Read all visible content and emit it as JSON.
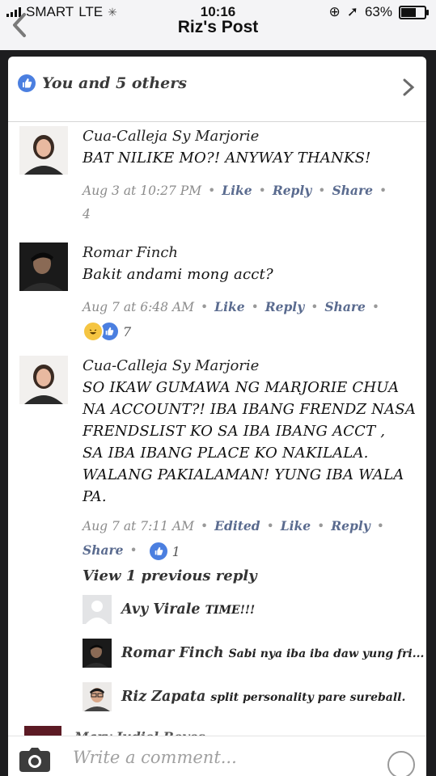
{
  "status_bar": {
    "carrier": "SMART",
    "network": "LTE",
    "time": "10:16",
    "battery": "63%"
  },
  "nav": {
    "title": "Riz's Post"
  },
  "likes": {
    "text": "You and 5 others"
  },
  "comments": [
    {
      "name": "Cua-Calleja Sy Marjorie",
      "lines": [
        "BAT NILIKE MO?! ANYWAY THANKS!"
      ],
      "time": "Aug 3 at 10:27 PM",
      "like": "Like",
      "reply": "Reply",
      "share": "Share",
      "count": "4"
    },
    {
      "name": "Romar Finch",
      "lines": [
        "Bakit andami mong acct?"
      ],
      "time": "Aug 7 at 6:48 AM",
      "like": "Like",
      "reply": "Reply",
      "share": "Share",
      "count": "7"
    },
    {
      "name": "Cua-Calleja Sy Marjorie",
      "lines": [
        "SO IKAW GUMAWA NG MARJORIE CHUA",
        "NA ACCOUNT?! IBA IBANG FRENDZ NASA",
        "FRENDSLIST KO SA IBA IBANG ACCT ,",
        "SA IBA IBANG PLACE KO NAKILALA.",
        "WALANG PAKIALAMAN! YUNG IBA WALA",
        "PA."
      ],
      "time": "Aug 7 at 7:11 AM",
      "edited": "Edited",
      "like": "Like",
      "reply": "Reply",
      "share": "Share",
      "count": "1"
    }
  ],
  "view_previous": "View 1 previous reply",
  "replies": [
    {
      "name": "Avy Virale",
      "text": "TIME!!!"
    },
    {
      "name": "Romar Finch",
      "text": "Sabi nya iba iba daw yung fri..."
    },
    {
      "name": "Riz Zapata",
      "text": "split personality pare sureball."
    }
  ],
  "partial_comment": {
    "name": "Mary Judiel Reyes"
  },
  "composer": {
    "placeholder": "Write a comment..."
  },
  "colors": {
    "accent": "#4b7fe0",
    "meta_link": "#5a6b8f"
  }
}
